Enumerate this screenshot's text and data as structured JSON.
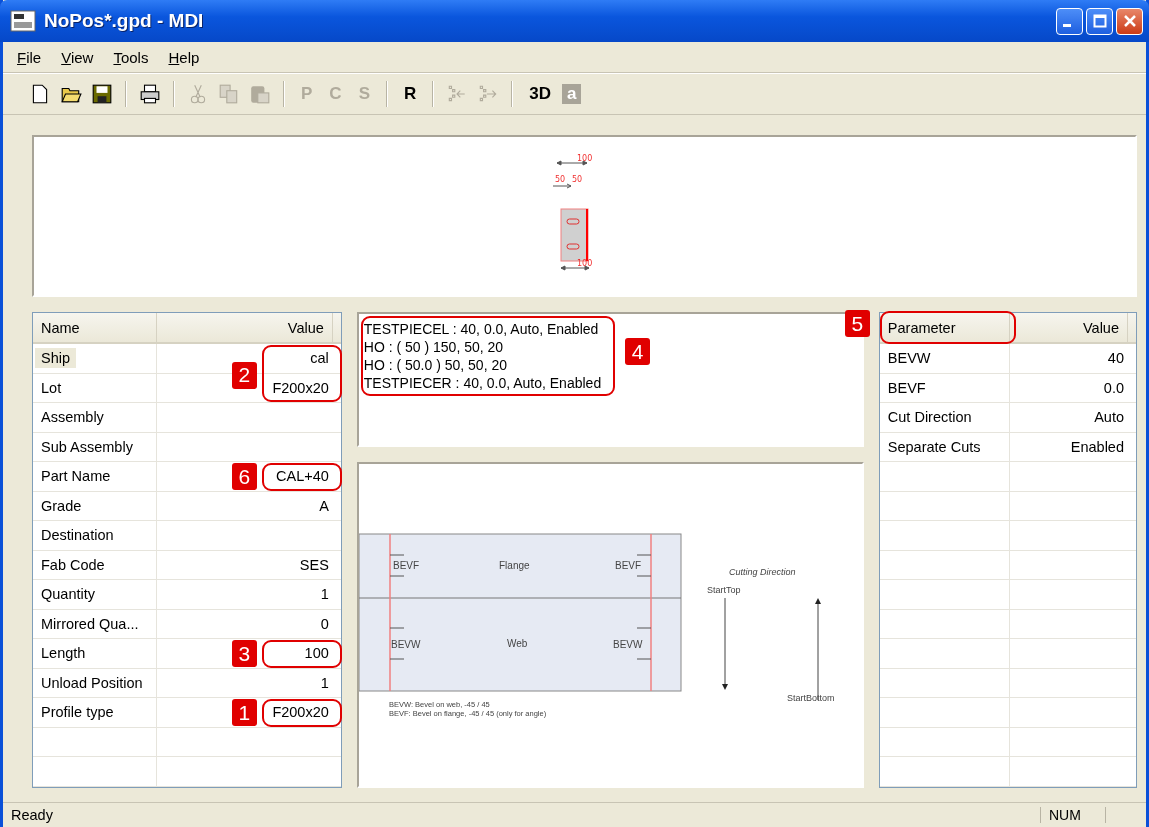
{
  "window": {
    "title": "NoPos*.gpd - MDI"
  },
  "menu": [
    {
      "label": "File"
    },
    {
      "label": "View"
    },
    {
      "label": "Tools"
    },
    {
      "label": "Help"
    }
  ],
  "toolbar": [
    {
      "kind": "document",
      "disabled": false
    },
    {
      "kind": "folder",
      "disabled": false
    },
    {
      "kind": "disk",
      "disabled": false
    },
    {
      "kind": "separator"
    },
    {
      "kind": "printer",
      "disabled": false
    },
    {
      "kind": "separator"
    },
    {
      "kind": "scissors",
      "disabled": true
    },
    {
      "kind": "copy",
      "disabled": true
    },
    {
      "kind": "clipboard",
      "disabled": true
    },
    {
      "kind": "separator"
    },
    {
      "kind": "text",
      "label": "P",
      "disabled": true
    },
    {
      "kind": "text",
      "label": "C",
      "disabled": true
    },
    {
      "kind": "text",
      "label": "S",
      "disabled": true
    },
    {
      "kind": "separator"
    },
    {
      "kind": "text",
      "label": "R",
      "disabled": false
    },
    {
      "kind": "separator"
    },
    {
      "kind": "merge",
      "disabled": true
    },
    {
      "kind": "split",
      "disabled": true
    },
    {
      "kind": "separator"
    },
    {
      "kind": "text",
      "label": "3D",
      "disabled": false
    },
    {
      "kind": "boxed",
      "label": "a",
      "disabled": false
    }
  ],
  "preview": {
    "top_dimension": "100",
    "hole_dimensions": [
      "50",
      "50"
    ],
    "bottom_dimension": "100"
  },
  "properties": {
    "columns": [
      "Name",
      "Value"
    ],
    "rows": [
      {
        "name": "Ship",
        "value": "cal",
        "selected": true,
        "callout": "2"
      },
      {
        "name": "Lot",
        "value": "F200x20",
        "selected": false,
        "callout_continued": true
      },
      {
        "name": "Assembly",
        "value": "",
        "selected": false
      },
      {
        "name": "Sub Assembly",
        "value": "",
        "selected": false
      },
      {
        "name": "Part Name",
        "value": "CAL+40",
        "selected": false,
        "callout": "6"
      },
      {
        "name": "Grade",
        "value": "A",
        "selected": false
      },
      {
        "name": "Destination",
        "value": "",
        "selected": false
      },
      {
        "name": "Fab Code",
        "value": "SES",
        "selected": false
      },
      {
        "name": "Quantity",
        "value": "1",
        "selected": false
      },
      {
        "name": "Mirrored Qua...",
        "value": "0",
        "selected": false
      },
      {
        "name": "Length",
        "value": "100",
        "selected": false,
        "callout": "3"
      },
      {
        "name": "Unload Position",
        "value": "1",
        "selected": false
      },
      {
        "name": "Profile type",
        "value": "F200x20",
        "selected": false,
        "callout": "1"
      }
    ]
  },
  "operations": {
    "lines": [
      "TESTPIECEL : 40, 0.0, Auto, Enabled",
      "HO : ( 50 ) 150, 50, 20",
      "HO : ( 50.0 ) 50, 50, 20",
      "TESTPIECER : 40, 0.0, Auto, Enabled"
    ],
    "callout": "4"
  },
  "diagram": {
    "flange_label": "Flange",
    "web_label": "Web",
    "bevf_labels": [
      "BEVF",
      "BEVF"
    ],
    "bevw_labels": [
      "BEVW",
      "BEVW"
    ],
    "direction_title": "Cutting Direction",
    "start_top": "StartTop",
    "start_bottom": "StartBottom",
    "legend": [
      "BEVW: Bevel on web, -45 / 45",
      "BEVF: Bevel on flange, -45 / 45 (only for angle)"
    ]
  },
  "parameters": {
    "columns": [
      "Parameter",
      "Value"
    ],
    "header_callout": "5",
    "rows": [
      {
        "name": "BEVW",
        "value": "40"
      },
      {
        "name": "BEVF",
        "value": "0.0"
      },
      {
        "name": "Cut Direction",
        "value": "Auto"
      },
      {
        "name": "Separate Cuts",
        "value": "Enabled"
      }
    ]
  },
  "status_bar": {
    "message": "Ready",
    "indicator": "NUM"
  }
}
